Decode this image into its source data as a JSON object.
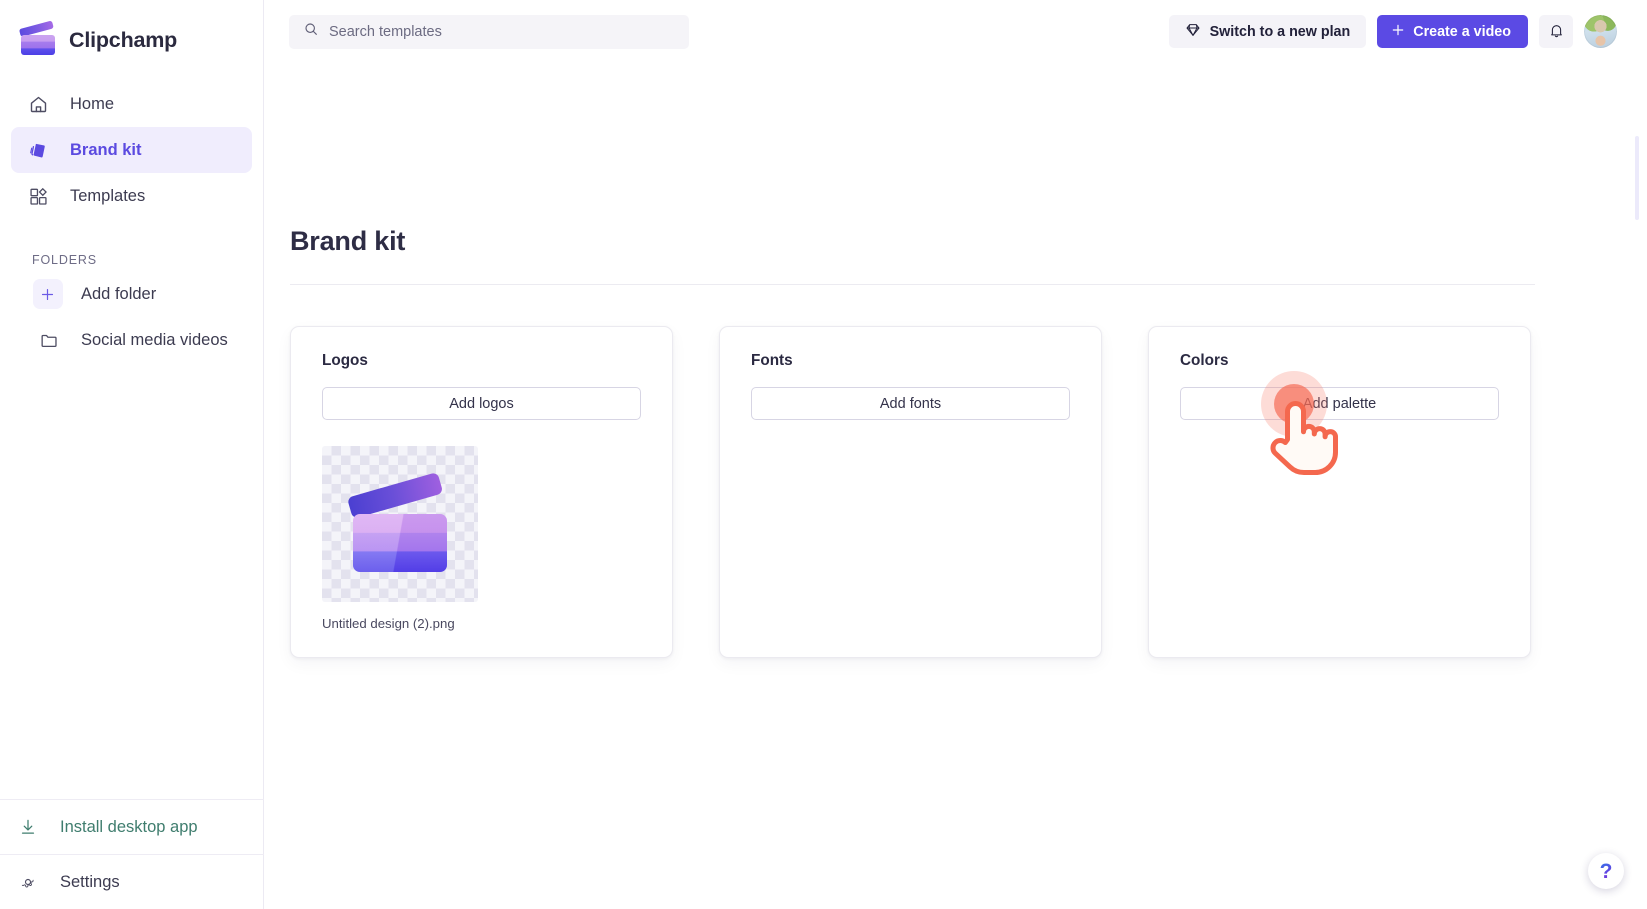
{
  "app": {
    "brand_name": "Clipchamp",
    "brand_icon": "clipchamp-logo-icon"
  },
  "sidebar": {
    "nav_items": [
      {
        "label": "Home",
        "icon": "home-icon",
        "active": false
      },
      {
        "label": "Brand kit",
        "icon": "brand-kit-icon",
        "active": true
      },
      {
        "label": "Templates",
        "icon": "templates-grid-icon",
        "active": false
      }
    ],
    "folders_label": "FOLDERS",
    "folder_items": [
      {
        "label": "Add folder",
        "icon": "plus-icon"
      },
      {
        "label": "Social media videos",
        "icon": "folder-icon"
      }
    ],
    "bottom_items": [
      {
        "label": "Install desktop app",
        "icon": "download-icon",
        "color": "#3f7d6e"
      },
      {
        "label": "Settings",
        "icon": "gear-icon",
        "color": "#3c3b50"
      }
    ]
  },
  "topbar": {
    "search": {
      "placeholder": "Search templates",
      "value": "",
      "icon": "search-icon"
    },
    "switch_plan_label": "Switch to a new plan",
    "switch_plan_icon": "diamond-icon",
    "create_video_label": "Create a video",
    "create_video_icon": "plus-icon",
    "notifications_icon": "bell-icon",
    "avatar_icon": "avatar"
  },
  "main": {
    "page_title": "Brand kit",
    "cards": [
      {
        "title": "Logos",
        "button_label": "Add logos",
        "assets": [
          {
            "name": "Untitled design (2).png",
            "thumb": "clipchamp-clapperboard-thumbnail"
          }
        ]
      },
      {
        "title": "Fonts",
        "button_label": "Add fonts",
        "assets": []
      },
      {
        "title": "Colors",
        "button_label": "Add palette",
        "assets": []
      }
    ]
  },
  "overlay": {
    "cursor_icon": "pointing-hand-cursor",
    "cursor_target": "Add fonts",
    "help_label": "?",
    "help_icon": "question-mark-icon"
  },
  "colors": {
    "accent": "#5b4ae4",
    "accent_soft": "#f0edfd",
    "text": "#3c3b50",
    "muted": "#6e6c86",
    "install_green": "#3f7d6e",
    "cursor_orange": "#f46852",
    "card_border": "#ebeaf0"
  }
}
